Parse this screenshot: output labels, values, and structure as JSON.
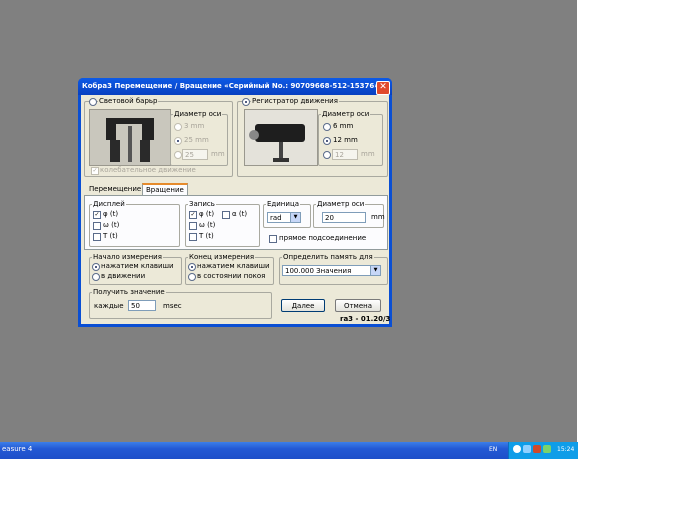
{
  "window": {
    "title": "Кобра3 Перемещение / Вращение  «Серийный No.: 90709668-512-15376»",
    "close_glyph": "✕"
  },
  "light_barrier": {
    "label": "Световой барьр",
    "axis_diameter_label": "Диаметр оси",
    "options": [
      "3 mm",
      "25 mm"
    ],
    "custom_value": "25",
    "unit": "mm",
    "oscillation_label": "колебательное движение"
  },
  "motion_recorder": {
    "label": "Регистратор движения",
    "axis_diameter_label": "Диаметр оси",
    "options": [
      "6 mm",
      "12 mm"
    ],
    "custom_value": "12",
    "unit": "mm"
  },
  "tabs": [
    "Перемещение",
    "Вращение"
  ],
  "display": {
    "label": "Дисплей",
    "items": [
      "φ (t)",
      "ω (t)",
      "T (t)"
    ]
  },
  "record": {
    "label": "Запись",
    "items": [
      "φ (t)",
      "ω (t)",
      "T (t)",
      "α (t)"
    ]
  },
  "unit": {
    "label": "Единица",
    "value": "rad"
  },
  "axis_diameter": {
    "label": "Диаметр оси",
    "value": "20",
    "unit": "mm"
  },
  "direct_connection_label": "прямое подсоединение",
  "start": {
    "label": "Начало измерения",
    "options": [
      "нажатием клавиши",
      "в движении"
    ]
  },
  "end": {
    "label": "Конец измерения",
    "options": [
      "нажатием клавиши",
      "в состоянии покоя"
    ]
  },
  "memory": {
    "label": "Определить память для",
    "value": "100.000 Значения"
  },
  "get_value": {
    "label": "Получить значение",
    "every_label": "каждые",
    "value": "50",
    "unit": "msec"
  },
  "buttons": {
    "next": "Далее",
    "cancel": "Отмена"
  },
  "version": "ra3 - 01.20/3",
  "taskbar": {
    "task": "easure 4",
    "lang": "EN",
    "clock": "15:24"
  }
}
